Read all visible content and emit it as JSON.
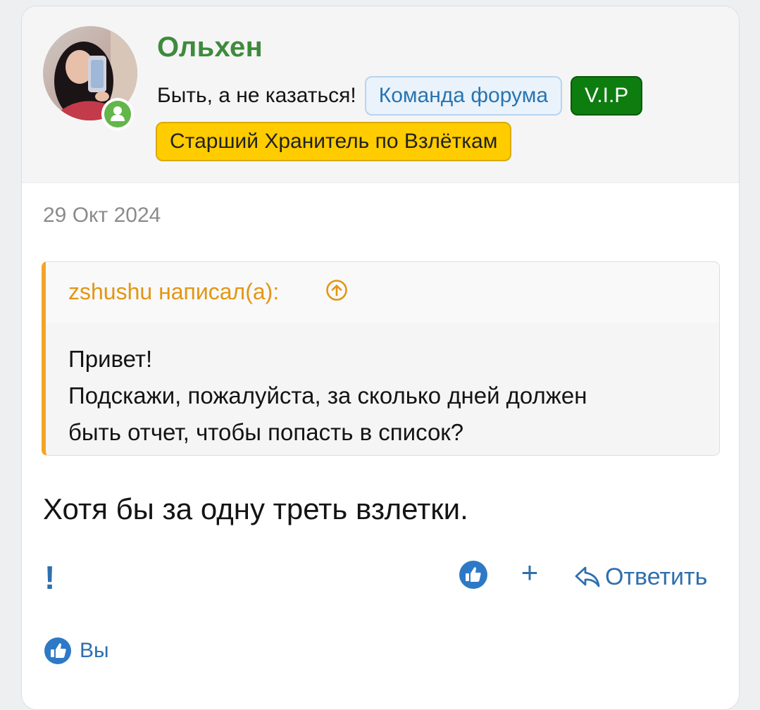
{
  "post": {
    "author": {
      "name": "Ольхен",
      "custom_title": "Быть, а не казаться!",
      "banners": [
        "Команда форума",
        "V.I.P",
        "Старший Хранитель по Взлёткам"
      ],
      "online": true
    },
    "date": "29 Окт 2024",
    "quote": {
      "attribution": "zshushu написал(а):",
      "lines": [
        "Привет!",
        "Подскажи, пожалуйста, за сколько дней должен",
        "быть отчет, чтобы попасть в список?"
      ]
    },
    "message": "Хотя бы за одну треть взлетки.",
    "actions": {
      "report_label": "!",
      "add_label": "+",
      "reply_label": "Ответить"
    },
    "reactions": {
      "users": "Вы"
    }
  },
  "colors": {
    "username": "#3f8a3c",
    "link": "#2e6fae",
    "quote_accent": "#f2a526",
    "vip": "#0e7d10",
    "keeper": "#ffcc00",
    "like": "#2e79c6"
  },
  "icons": {
    "online": "user-online-icon",
    "jump": "arrow-up-circle-icon",
    "like": "thumbs-up-icon",
    "reply": "reply-arrow-icon"
  }
}
